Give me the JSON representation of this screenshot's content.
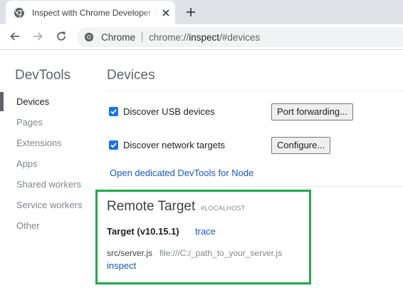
{
  "browser": {
    "tab_title": "Inspect with Chrome Developer Tools",
    "url_scheme_label": "Chrome",
    "url_prefix": "chrome://",
    "url_main": "inspect",
    "url_suffix": "/#devices"
  },
  "sidebar": {
    "title": "DevTools",
    "items": [
      {
        "label": "Devices",
        "active": true
      },
      {
        "label": "Pages",
        "active": false
      },
      {
        "label": "Extensions",
        "active": false
      },
      {
        "label": "Apps",
        "active": false
      },
      {
        "label": "Shared workers",
        "active": false
      },
      {
        "label": "Service workers",
        "active": false
      },
      {
        "label": "Other",
        "active": false
      }
    ]
  },
  "devices": {
    "title": "Devices",
    "discover_usb": {
      "label": "Discover USB devices",
      "checked": true,
      "button": "Port forwarding..."
    },
    "discover_network": {
      "label": "Discover network targets",
      "checked": true,
      "button": "Configure..."
    },
    "node_link": "Open dedicated DevTools for Node"
  },
  "remote_target": {
    "title": "Remote Target",
    "host": "#LOCALHOST",
    "target_name": "Target (v10.15.1)",
    "trace_link": "trace",
    "file": "src/server.js",
    "file_url": "file:///C:/_path_to_your_server.js",
    "inspect_link": "inspect"
  },
  "colors": {
    "highlight_border": "#22a94a",
    "link": "#1a56c0",
    "checkbox": "#1a73e8"
  }
}
